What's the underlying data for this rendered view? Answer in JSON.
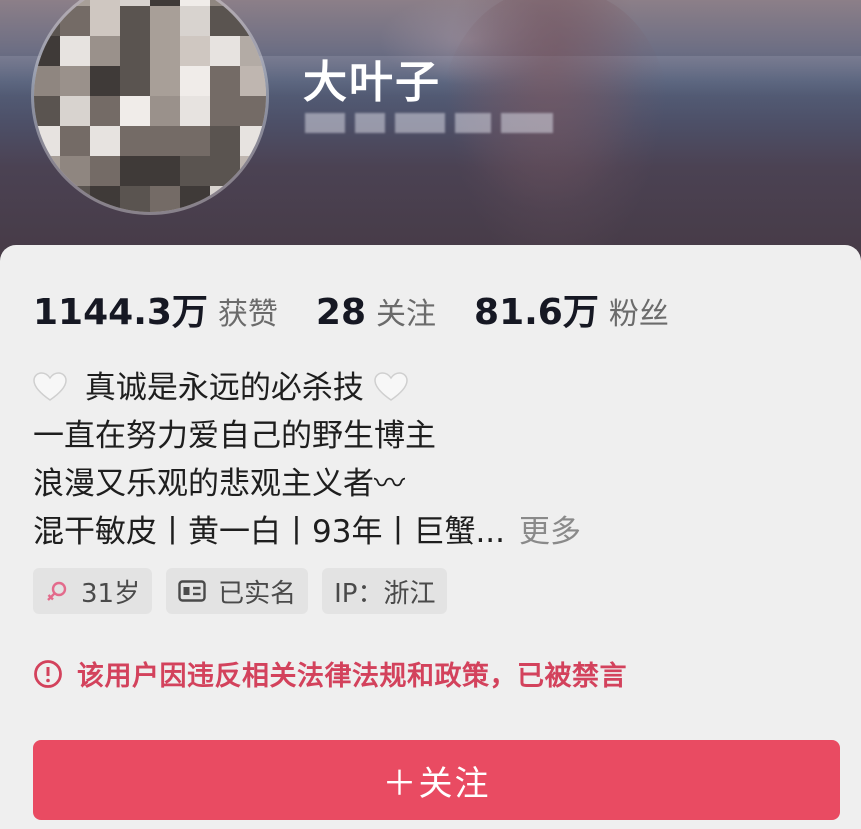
{
  "profile": {
    "name": "大叶子"
  },
  "stats": [
    {
      "value": "1144.3万",
      "label": "获赞"
    },
    {
      "value": "28",
      "label": "关注"
    },
    {
      "value": "81.6万",
      "label": "粉丝"
    }
  ],
  "bio": {
    "line1": "真诚是永远的必杀技",
    "line2": "一直在努力爱自己的野生博主",
    "line3": "浪漫又乐观的悲观主义者〰",
    "line4": "混干敏皮丨黄一白丨93年丨巨蟹...",
    "more": "更多"
  },
  "tags": {
    "age": "31岁",
    "verified": "已实名",
    "ip": "IP：浙江"
  },
  "notice": {
    "text": "该用户因违反相关法律法规和政策，已被禁言",
    "color": "#d3425c"
  },
  "actions": {
    "follow": "＋关注",
    "accent": "#e94b62"
  }
}
